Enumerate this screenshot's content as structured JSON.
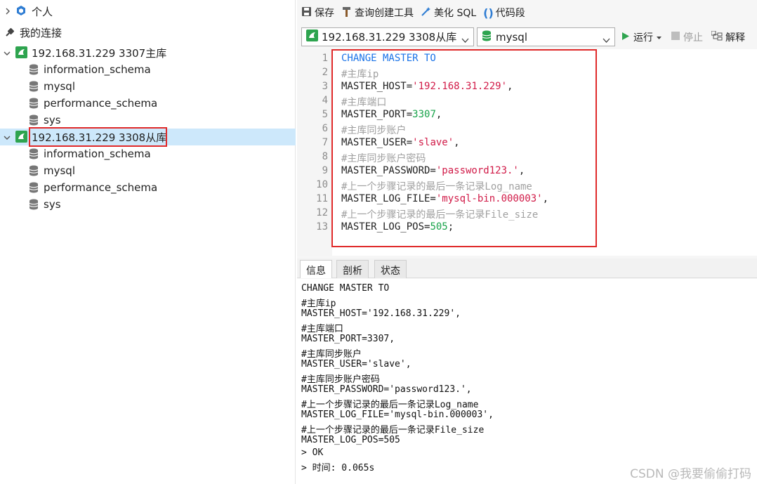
{
  "tree": {
    "personal": "个人",
    "my_connections": "我的连接",
    "conn1": {
      "label": "192.168.31.229 3307主库",
      "dbs": [
        "information_schema",
        "mysql",
        "performance_schema",
        "sys"
      ]
    },
    "conn2": {
      "label": "192.168.31.229 3308从库",
      "dbs": [
        "information_schema",
        "mysql",
        "performance_schema",
        "sys"
      ]
    }
  },
  "toolbar": {
    "save": "保存",
    "query_builder": "查询创建工具",
    "beautify": "美化 SQL",
    "snippet": "代码段"
  },
  "toolbar2": {
    "connection": "192.168.31.229 3308从库",
    "database": "mysql",
    "run": "运行",
    "stop": "停止",
    "explain": "解释"
  },
  "editor": {
    "lines": [
      "CHANGE MASTER TO",
      "#主库ip",
      "MASTER_HOST='192.168.31.229',",
      "#主库端口",
      "MASTER_PORT=3307,",
      "#主库同步账户",
      "MASTER_USER='slave',",
      "#主库同步账户密码",
      "MASTER_PASSWORD='password123.',",
      "#上一个步骤记录的最后一条记录Log_name",
      "MASTER_LOG_FILE='mysql-bin.000003',",
      "#上一个步骤记录的最后一条记录File_size",
      "MASTER_LOG_POS=505;"
    ],
    "line_numbers": [
      "1",
      "2",
      "3",
      "4",
      "5",
      "6",
      "7",
      "8",
      "9",
      "10",
      "11",
      "12",
      "13"
    ]
  },
  "tabs": [
    "信息",
    "剖析",
    "状态"
  ],
  "output": [
    "CHANGE MASTER TO",
    "#主库ip",
    "MASTER_HOST='192.168.31.229',",
    "#主库端口",
    "MASTER_PORT=3307,",
    "#主库同步账户",
    "MASTER_USER='slave',",
    "#主库同步账户密码",
    "MASTER_PASSWORD='password123.',",
    "#上一个步骤记录的最后一条记录Log_name",
    "MASTER_LOG_FILE='mysql-bin.000003',",
    "#上一个步骤记录的最后一条记录File_size",
    "MASTER_LOG_POS=505",
    "> OK",
    "> 时间: 0.065s"
  ],
  "watermark": "CSDN @我要偷偷打码",
  "colors": {
    "keyword": "#1a73e8",
    "comment": "#a0a0a0",
    "string": "#d11b48",
    "number": "#18a34a",
    "highlight": "#e02a2a",
    "selection": "#cde8fb"
  }
}
